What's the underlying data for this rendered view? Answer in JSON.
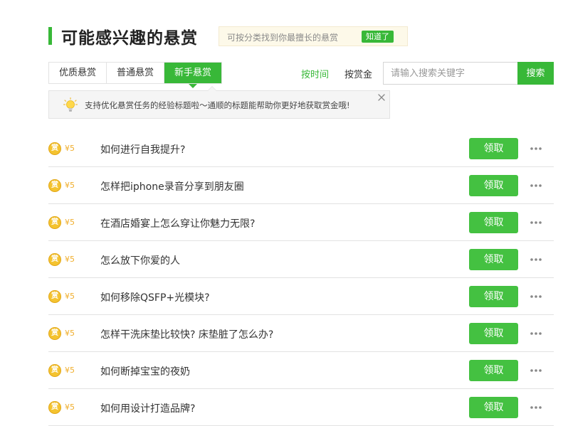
{
  "header": {
    "title": "可能感兴趣的悬赏",
    "tip_text": "可按分类找到你最擅长的悬赏",
    "tip_button": "知道了"
  },
  "tabs": [
    {
      "label": "优质悬赏",
      "active": false
    },
    {
      "label": "普通悬赏",
      "active": false
    },
    {
      "label": "新手悬赏",
      "active": true
    }
  ],
  "sort": {
    "time_label": "按时间",
    "reward_label": "按赏金"
  },
  "search": {
    "placeholder": "请输入搜索关键字",
    "button_label": "搜索"
  },
  "notice": {
    "text": "支持优化悬赏任务的经验标题啦～通顺的标题能帮助你更好地获取赏金哦!",
    "icon": "lightbulb-icon"
  },
  "reward_badge": "赏",
  "claim_label": "领取",
  "colors": {
    "accent": "#38b838",
    "reward": "#f0ad2a",
    "coin": "#f4c330"
  },
  "questions": [
    {
      "reward": "¥5",
      "title": "如何进行自我提升?"
    },
    {
      "reward": "¥5",
      "title": "怎样把iphone录音分享到朋友圈"
    },
    {
      "reward": "¥5",
      "title": "在酒店婚宴上怎么穿让你魅力无限?"
    },
    {
      "reward": "¥5",
      "title": "怎么放下你爱的人"
    },
    {
      "reward": "¥5",
      "title": "如何移除QSFP+光模块?"
    },
    {
      "reward": "¥5",
      "title": "怎样干洗床垫比较快? 床垫脏了怎么办?"
    },
    {
      "reward": "¥5",
      "title": "如何断掉宝宝的夜奶"
    },
    {
      "reward": "¥5",
      "title": "如何用设计打造品牌?"
    }
  ]
}
